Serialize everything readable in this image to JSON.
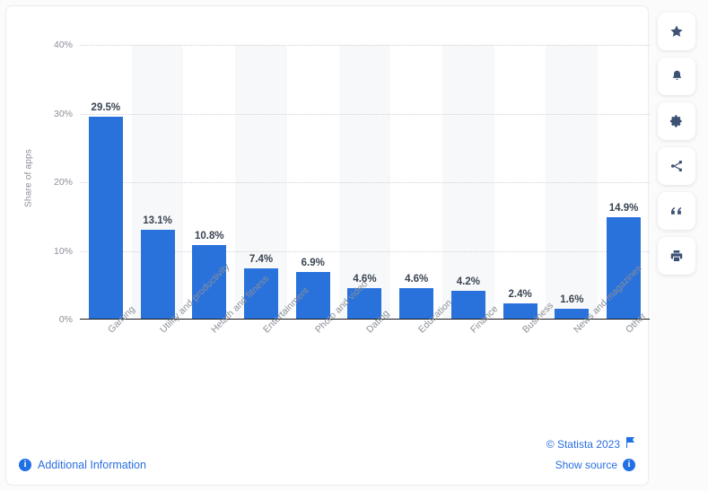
{
  "chart_data": {
    "type": "bar",
    "title": "",
    "xlabel": "",
    "ylabel": "Share of apps",
    "ylim": [
      0,
      40
    ],
    "grid": true,
    "legend": "none",
    "y_ticks": [
      "0%",
      "10%",
      "20%",
      "30%",
      "40%"
    ],
    "y_tick_values": [
      0,
      10,
      20,
      30,
      40
    ],
    "categories": [
      "Gaming",
      "Utility and productivity",
      "Helath and fitness",
      "Entertainment",
      "Photo and video",
      "Dating",
      "Education",
      "Finance",
      "Business",
      "News and magazines",
      "Other"
    ],
    "values": [
      29.5,
      13.1,
      10.8,
      7.4,
      6.9,
      4.6,
      4.6,
      4.2,
      2.4,
      1.6,
      14.9
    ],
    "value_labels": [
      "29.5%",
      "13.1%",
      "10.8%",
      "7.4%",
      "6.9%",
      "4.6%",
      "4.6%",
      "4.2%",
      "2.4%",
      "1.6%",
      "14.9%"
    ],
    "bar_color": "#2a72db",
    "label_color": "#3a4452",
    "axis_text_color": "#8a8f98"
  },
  "footer": {
    "additional_information": "Additional Information",
    "copyright": "© Statista 2023",
    "show_source": "Show source"
  },
  "toolbar": {
    "items": [
      {
        "icon": "star-icon",
        "label": "Favorite"
      },
      {
        "icon": "bell-icon",
        "label": "Notifications"
      },
      {
        "icon": "gear-icon",
        "label": "Settings"
      },
      {
        "icon": "share-icon",
        "label": "Share"
      },
      {
        "icon": "quote-icon",
        "label": "Citation"
      },
      {
        "icon": "print-icon",
        "label": "Print"
      }
    ]
  }
}
